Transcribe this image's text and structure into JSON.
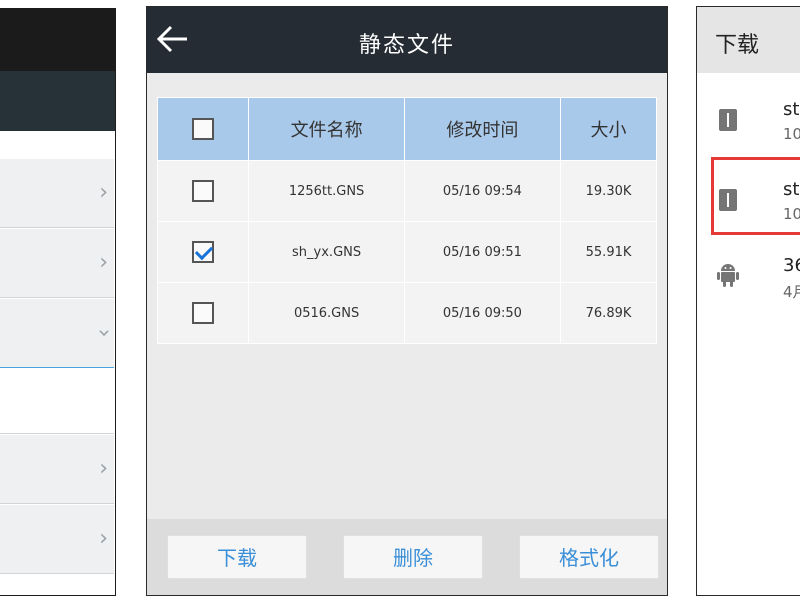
{
  "left_panel": {
    "rows": [
      {
        "chevron": "right"
      },
      {
        "chevron": "right"
      },
      {
        "chevron": "down"
      },
      {
        "chevron": ""
      },
      {
        "chevron": "right"
      },
      {
        "chevron": "right"
      }
    ]
  },
  "middle_panel": {
    "title": "静态文件",
    "back_icon": "←",
    "columns": [
      "文件名称",
      "修改时间",
      "大小"
    ],
    "files": [
      {
        "name": "1256tt.GNS",
        "time": "05/16 09:54",
        "size": "19.30K",
        "checked": false
      },
      {
        "name": "sh_yx.GNS",
        "time": "05/16 09:51",
        "size": "55.91K",
        "checked": true
      },
      {
        "name": "0516.GNS",
        "time": "05/16 09:50",
        "size": "76.89K",
        "checked": false
      }
    ],
    "buttons": {
      "download": "下载",
      "delete": "删除",
      "format": "格式化"
    },
    "colors": {
      "header_bg": "#252c33",
      "table_header_bg": "#a9c9ea",
      "button_text": "#3a8fd8",
      "check": "#1a73d9"
    }
  },
  "right_panel": {
    "title": "下载",
    "items": [
      {
        "line1": "st",
        "line2": "10",
        "icon": "file-icon"
      },
      {
        "line1": "st",
        "line2": "10",
        "icon": "file-icon",
        "highlighted": true
      },
      {
        "line1": "36",
        "line2": "4月",
        "icon": "android-icon"
      }
    ],
    "colors": {
      "highlight": "#e53935"
    }
  }
}
